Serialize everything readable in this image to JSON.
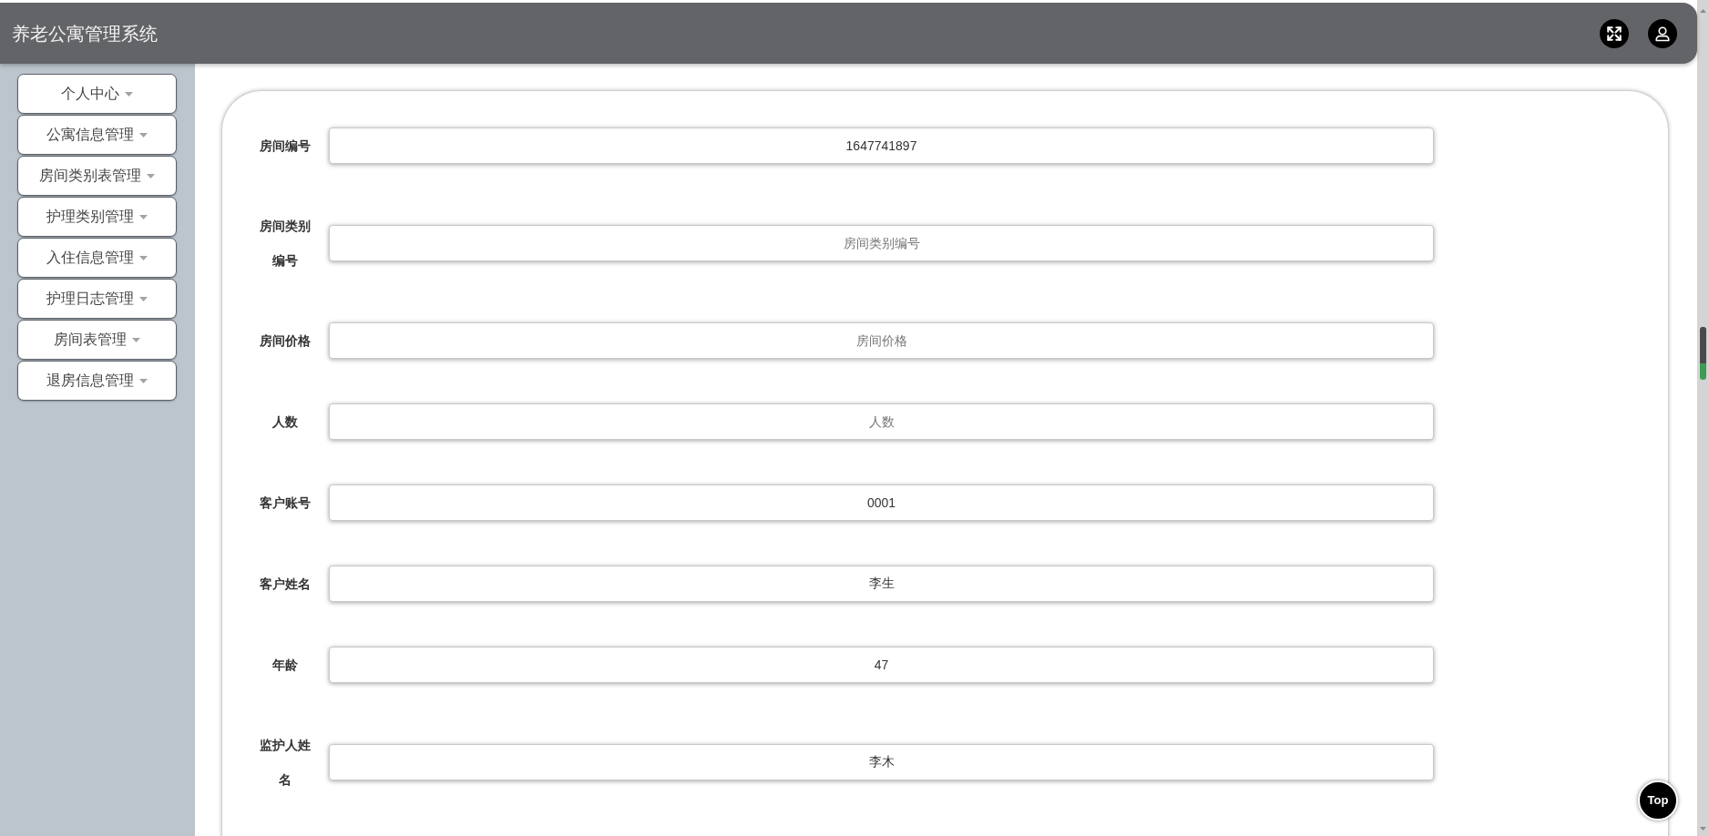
{
  "header": {
    "title": "养老公寓管理系统"
  },
  "sidebar": {
    "items": [
      {
        "label": "个人中心"
      },
      {
        "label": "公寓信息管理"
      },
      {
        "label": "房间类别表管理"
      },
      {
        "label": "护理类别管理"
      },
      {
        "label": "入住信息管理"
      },
      {
        "label": "护理日志管理"
      },
      {
        "label": "房间表管理"
      },
      {
        "label": "退房信息管理"
      }
    ]
  },
  "form": {
    "fields": [
      {
        "label": "房间编号",
        "value": "1647741897"
      },
      {
        "label": "房间类别编号",
        "placeholder": "房间类别编号"
      },
      {
        "label": "房间价格",
        "placeholder": "房间价格"
      },
      {
        "label": "人数",
        "placeholder": "人数"
      },
      {
        "label": "客户账号",
        "value": "0001"
      },
      {
        "label": "客户姓名",
        "value": "李生"
      },
      {
        "label": "年龄",
        "value": "47"
      },
      {
        "label": "监护人姓名",
        "value": "李木"
      }
    ]
  },
  "back_to_top": {
    "label": "Top"
  }
}
